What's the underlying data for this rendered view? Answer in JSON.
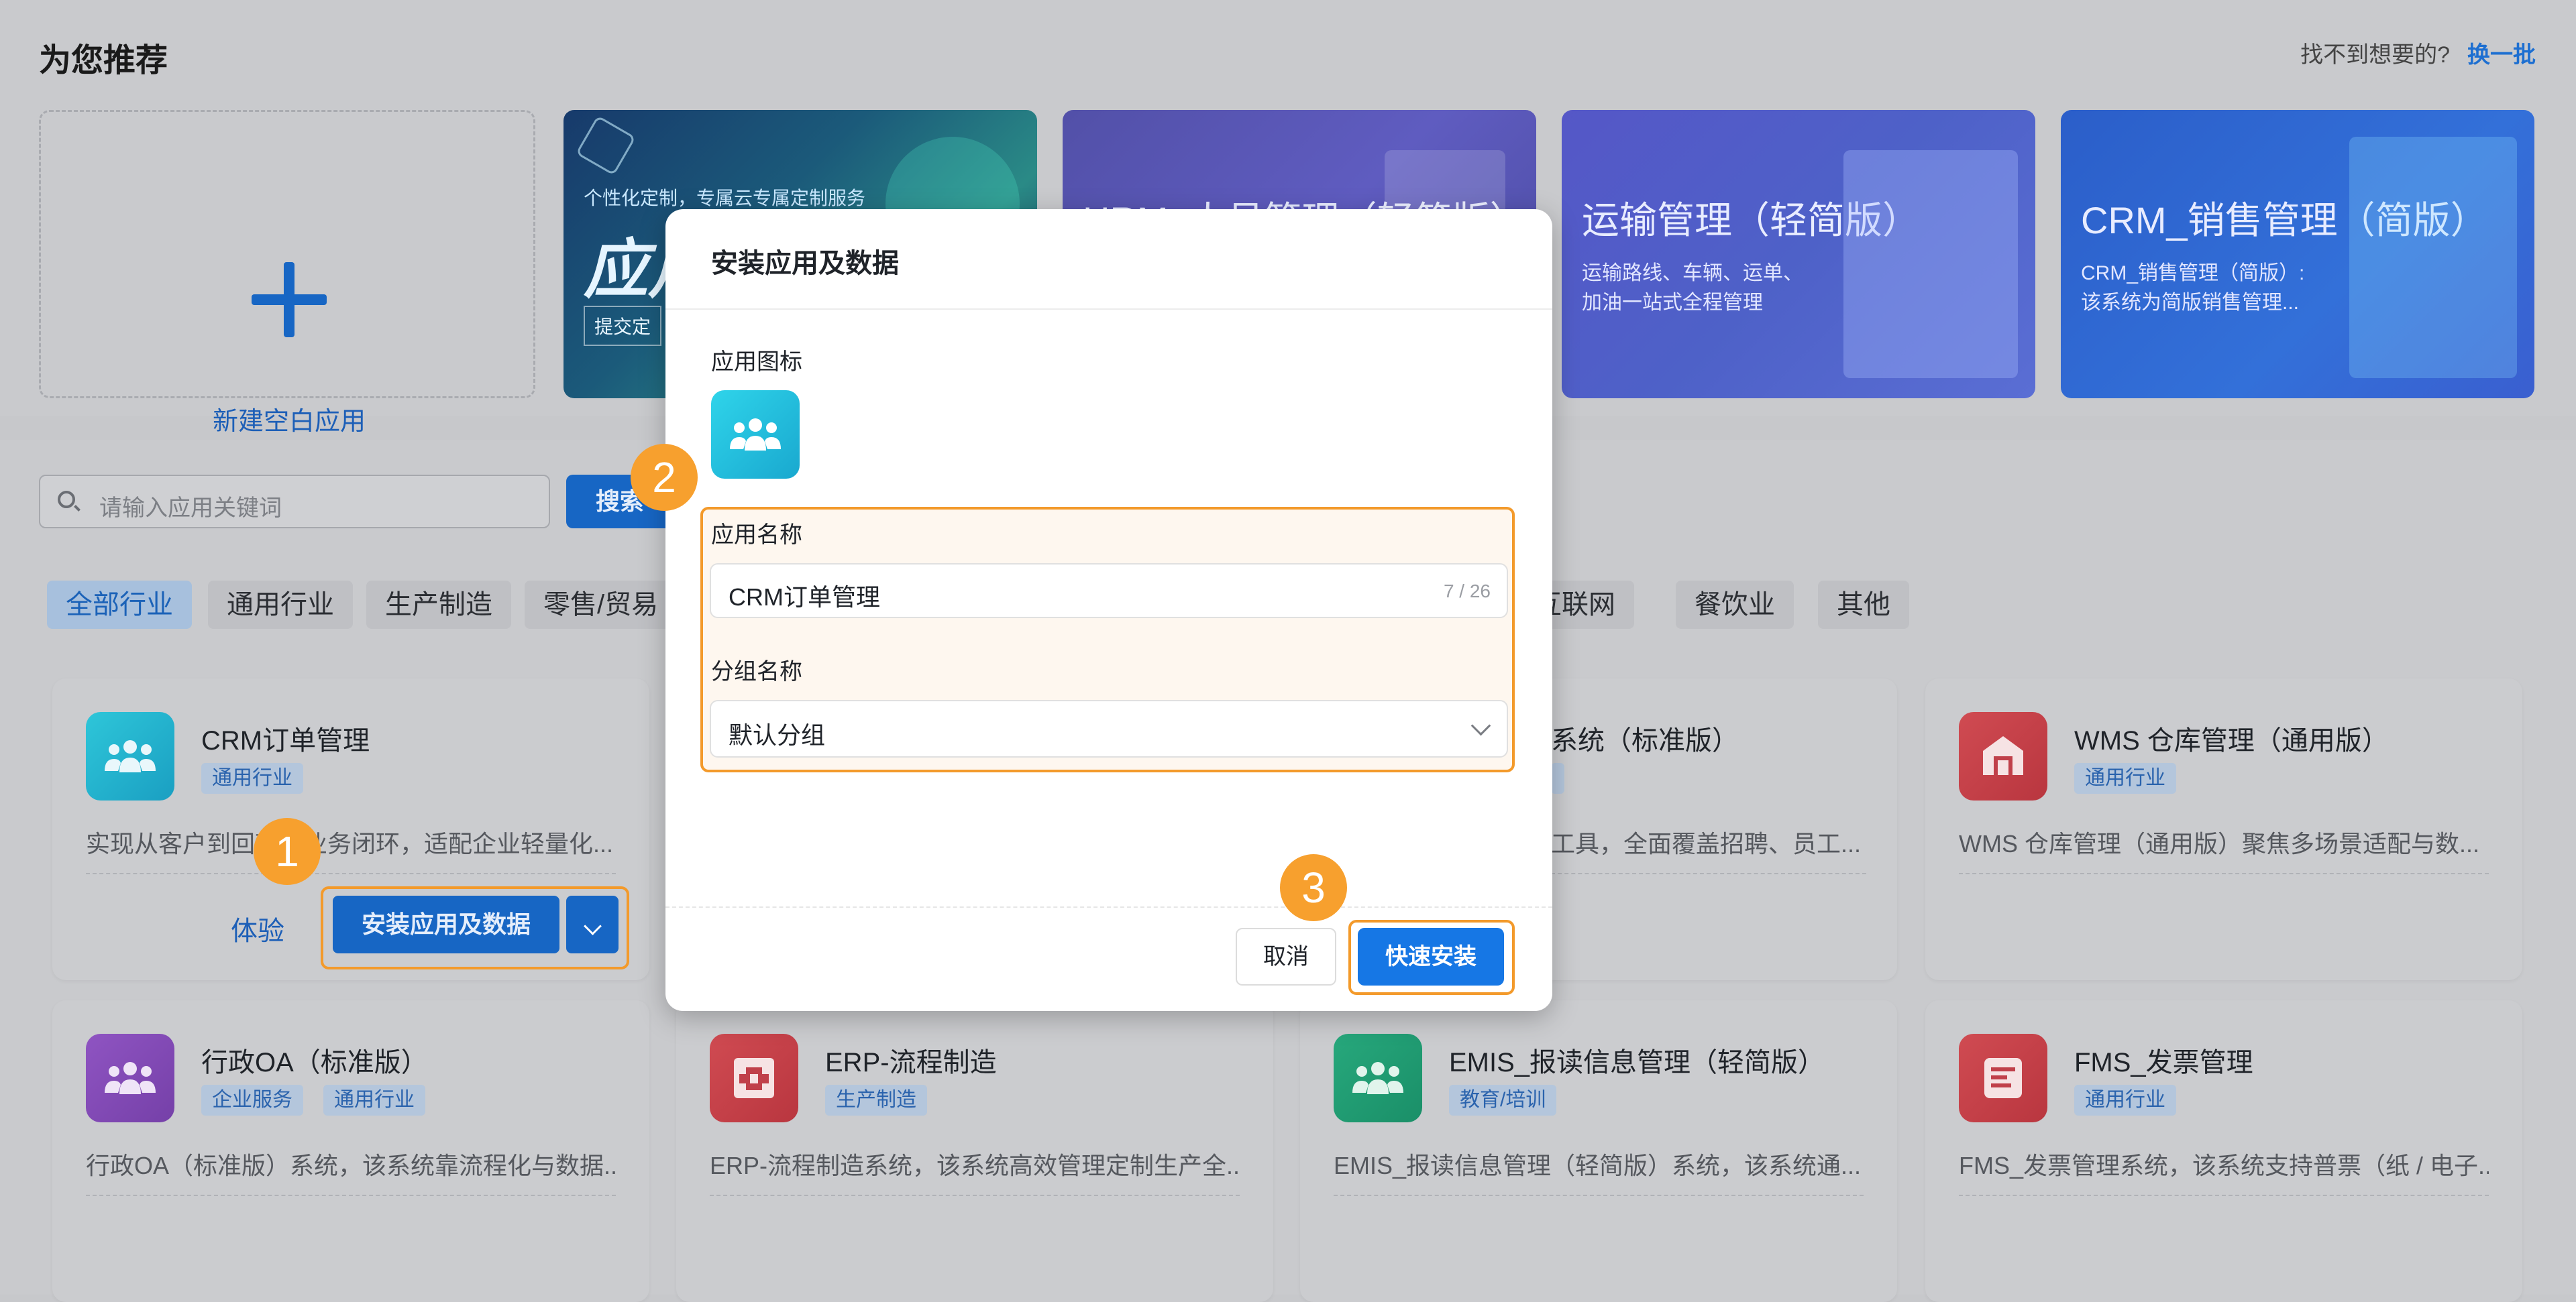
{
  "recommend": {
    "title": "为您推荐",
    "not_found_text": "找不到想要的?",
    "refresh_link": "换一批",
    "new_blank_label": "新建空白应用",
    "banners": [
      {
        "small": "个性化定制，专属云专属定制服务",
        "big": "应用",
        "sub": "提交定"
      },
      {
        "heading": "HRM_人员管理（轻简版）"
      },
      {
        "heading": "运输管理（轻简版）",
        "sub1": "运输路线、车辆、运单、",
        "sub2": "加油一站式全程管理"
      },
      {
        "heading": "CRM_销售管理（简版）",
        "sub1": "CRM_销售管理（简版）:",
        "sub2": "该系统为简版销售管理..."
      }
    ]
  },
  "search": {
    "placeholder": "请输入应用关键词",
    "button": "搜索"
  },
  "categories": [
    "全部行业",
    "通用行业",
    "生产制造",
    "零售/贸易",
    "互联网",
    "餐饮业",
    "其他"
  ],
  "cards": [
    {
      "title": "CRM订单管理",
      "tags": [
        "通用行业"
      ],
      "desc": "实现从客户到回款全业务闭环，适配企业轻量化...",
      "icon": "people-icon",
      "try": "体验",
      "install": "安装应用及数据"
    },
    {
      "title": "系统（标准版）",
      "tags": [],
      "desc": "工具，全面覆盖招聘、员工...",
      "icon": "people-icon"
    },
    {
      "title": "WMS 仓库管理（通用版）",
      "tags": [
        "通用行业"
      ],
      "desc": "WMS 仓库管理（通用版）聚焦多场景适配与数...",
      "icon": "warehouse-icon"
    },
    {
      "title": "行政OA（标准版）",
      "tags": [
        "企业服务",
        "通用行业"
      ],
      "desc": "行政OA（标准版）系统，该系统靠流程化与数据...",
      "icon": "people-icon"
    },
    {
      "title": "ERP-流程制造",
      "tags": [
        "生产制造"
      ],
      "desc": "ERP-流程制造系统，该系统高效管理定制生产全...",
      "icon": "factory-icon"
    },
    {
      "title": "EMIS_报读信息管理（轻简版）",
      "tags": [
        "教育/培训"
      ],
      "desc": "EMIS_报读信息管理（轻简版）系统，该系统通...",
      "icon": "people-icon"
    },
    {
      "title": "FMS_发票管理",
      "tags": [
        "通用行业"
      ],
      "desc": "FMS_发票管理系统，该系统支持普票（纸 / 电子...",
      "icon": "invoice-icon"
    }
  ],
  "modal": {
    "title": "安装应用及数据",
    "icon_label": "应用图标",
    "name_label": "应用名称",
    "name_value": "CRM订单管理",
    "name_count": "7 / 26",
    "group_label": "分组名称",
    "group_value": "默认分组",
    "cancel": "取消",
    "quick_install": "快速安装"
  },
  "steps": [
    "1",
    "2",
    "3"
  ],
  "colors": {
    "accent": "#1677e5",
    "highlight": "#f39a2b"
  }
}
